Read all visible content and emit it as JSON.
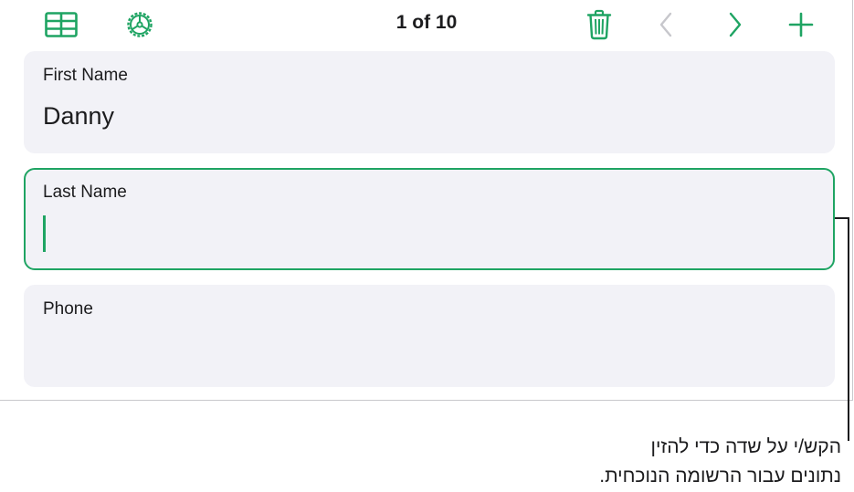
{
  "toolbar": {
    "record_counter": "1 of 10",
    "icons": {
      "table": "table-icon",
      "settings": "gear-wheel-icon",
      "delete": "trash-icon",
      "previous": "chevron-left-icon",
      "next": "chevron-right-icon",
      "add": "plus-icon"
    }
  },
  "fields": [
    {
      "label": "First Name",
      "value": "Danny"
    },
    {
      "label": "Last Name",
      "value": ""
    },
    {
      "label": "Phone",
      "value": ""
    }
  ],
  "callout": {
    "line1": "הקש/י על שדה כדי להזין",
    "line2": "נתונים עבור הרשומה הנוכחית."
  },
  "colors": {
    "accent": "#1fa463",
    "card_background": "#f2f2f7",
    "disabled_icon": "#c7c7cc"
  }
}
